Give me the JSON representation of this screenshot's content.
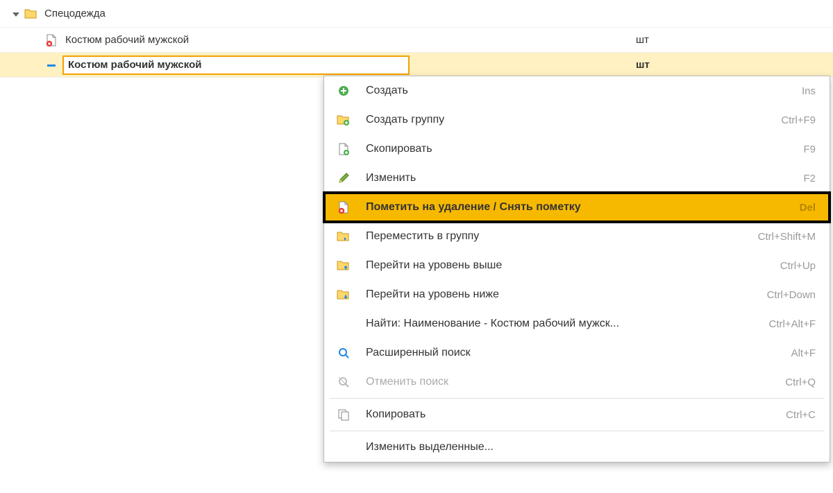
{
  "tree": {
    "group_label": "Спецодежда",
    "rows": [
      {
        "name": "Костюм рабочий мужской",
        "unit": "шт"
      },
      {
        "name": "Костюм рабочий мужской",
        "unit": "шт"
      }
    ]
  },
  "context_menu": {
    "items": [
      {
        "label": "Создать",
        "shortcut": "Ins",
        "icon": "plus-circle-green"
      },
      {
        "label": "Создать группу",
        "shortcut": "Ctrl+F9",
        "icon": "folder-plus"
      },
      {
        "label": "Скопировать",
        "shortcut": "F9",
        "icon": "doc-plus"
      },
      {
        "label": "Изменить",
        "shortcut": "F2",
        "icon": "pencil"
      },
      {
        "label": "Пометить на удаление / Снять пометку",
        "shortcut": "Del",
        "icon": "doc-x-red",
        "highlight": true
      },
      {
        "label": "Переместить в группу",
        "shortcut": "Ctrl+Shift+M",
        "icon": "folder-arrow"
      },
      {
        "label": "Перейти на уровень выше",
        "shortcut": "Ctrl+Up",
        "icon": "folder-up"
      },
      {
        "label": "Перейти на уровень ниже",
        "shortcut": "Ctrl+Down",
        "icon": "folder-down"
      },
      {
        "label": "Найти: Наименование - Костюм рабочий мужск...",
        "shortcut": "Ctrl+Alt+F",
        "icon": ""
      },
      {
        "label": "Расширенный поиск",
        "shortcut": "Alt+F",
        "icon": "search-plus"
      },
      {
        "label": "Отменить поиск",
        "shortcut": "Ctrl+Q",
        "icon": "search-x",
        "disabled": true
      },
      {
        "sep": true
      },
      {
        "label": "Копировать",
        "shortcut": "Ctrl+C",
        "icon": "copy"
      },
      {
        "sep": true
      },
      {
        "label": "Изменить выделенные...",
        "shortcut": "",
        "icon": ""
      }
    ]
  }
}
